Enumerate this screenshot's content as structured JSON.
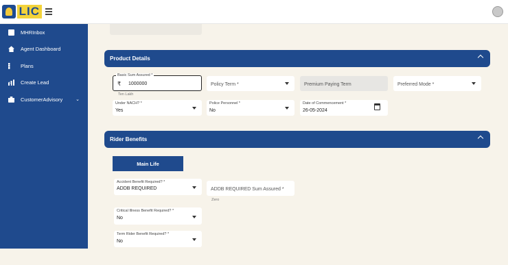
{
  "header": {
    "logo_text": "LIC",
    "menu_icon": "hamburger-menu-icon",
    "avatar_icon": "user-avatar-icon"
  },
  "sidebar": {
    "items": [
      {
        "label": "MHRInbox",
        "icon": "inbox-icon"
      },
      {
        "label": "Agent Dashboard",
        "icon": "home-icon"
      },
      {
        "label": "Plans",
        "icon": "grid-icon"
      },
      {
        "label": "Create Lead",
        "icon": "bar-chart-icon"
      },
      {
        "label": "CustomerAdvisory",
        "icon": "briefcase-icon",
        "has_submenu": true
      }
    ]
  },
  "product_details": {
    "title": "Product Details",
    "basic_sum_assured": {
      "label": "Basic Sum Assured *",
      "currency": "₹",
      "value": "1000000",
      "helper": "Ten Lakh"
    },
    "policy_term": {
      "placeholder": "Policy Term *"
    },
    "premium_paying_term": {
      "placeholder": "Premium Paying Term"
    },
    "preferred_mode": {
      "placeholder": "Preferred Mode *"
    },
    "under_nach": {
      "label": "Under NACH? *",
      "value": "Yes"
    },
    "police_personnel": {
      "label": "Police Personnel *",
      "value": "No"
    },
    "date_of_commencement": {
      "label": "Date of Commencement *",
      "value": "26-05-2024"
    }
  },
  "rider_benefits": {
    "title": "Rider Benefits",
    "tab_label": "Main Life",
    "accident_benefit": {
      "label": "Accident Benefit Required? *",
      "value": "ADDB REQUIRED"
    },
    "addb_sum_assured": {
      "placeholder": "ADDB REQUIRED Sum Assured *",
      "helper": "Zero"
    },
    "critical_illness": {
      "label": "Critical Illness Benefit Required? *",
      "value": "No"
    },
    "term_rider": {
      "label": "Term Rider Benefit Required? *",
      "value": "No"
    }
  },
  "colors": {
    "primary": "#1f4a8d",
    "background": "#f7f3ea",
    "logo_yellow": "#f3d33b"
  }
}
